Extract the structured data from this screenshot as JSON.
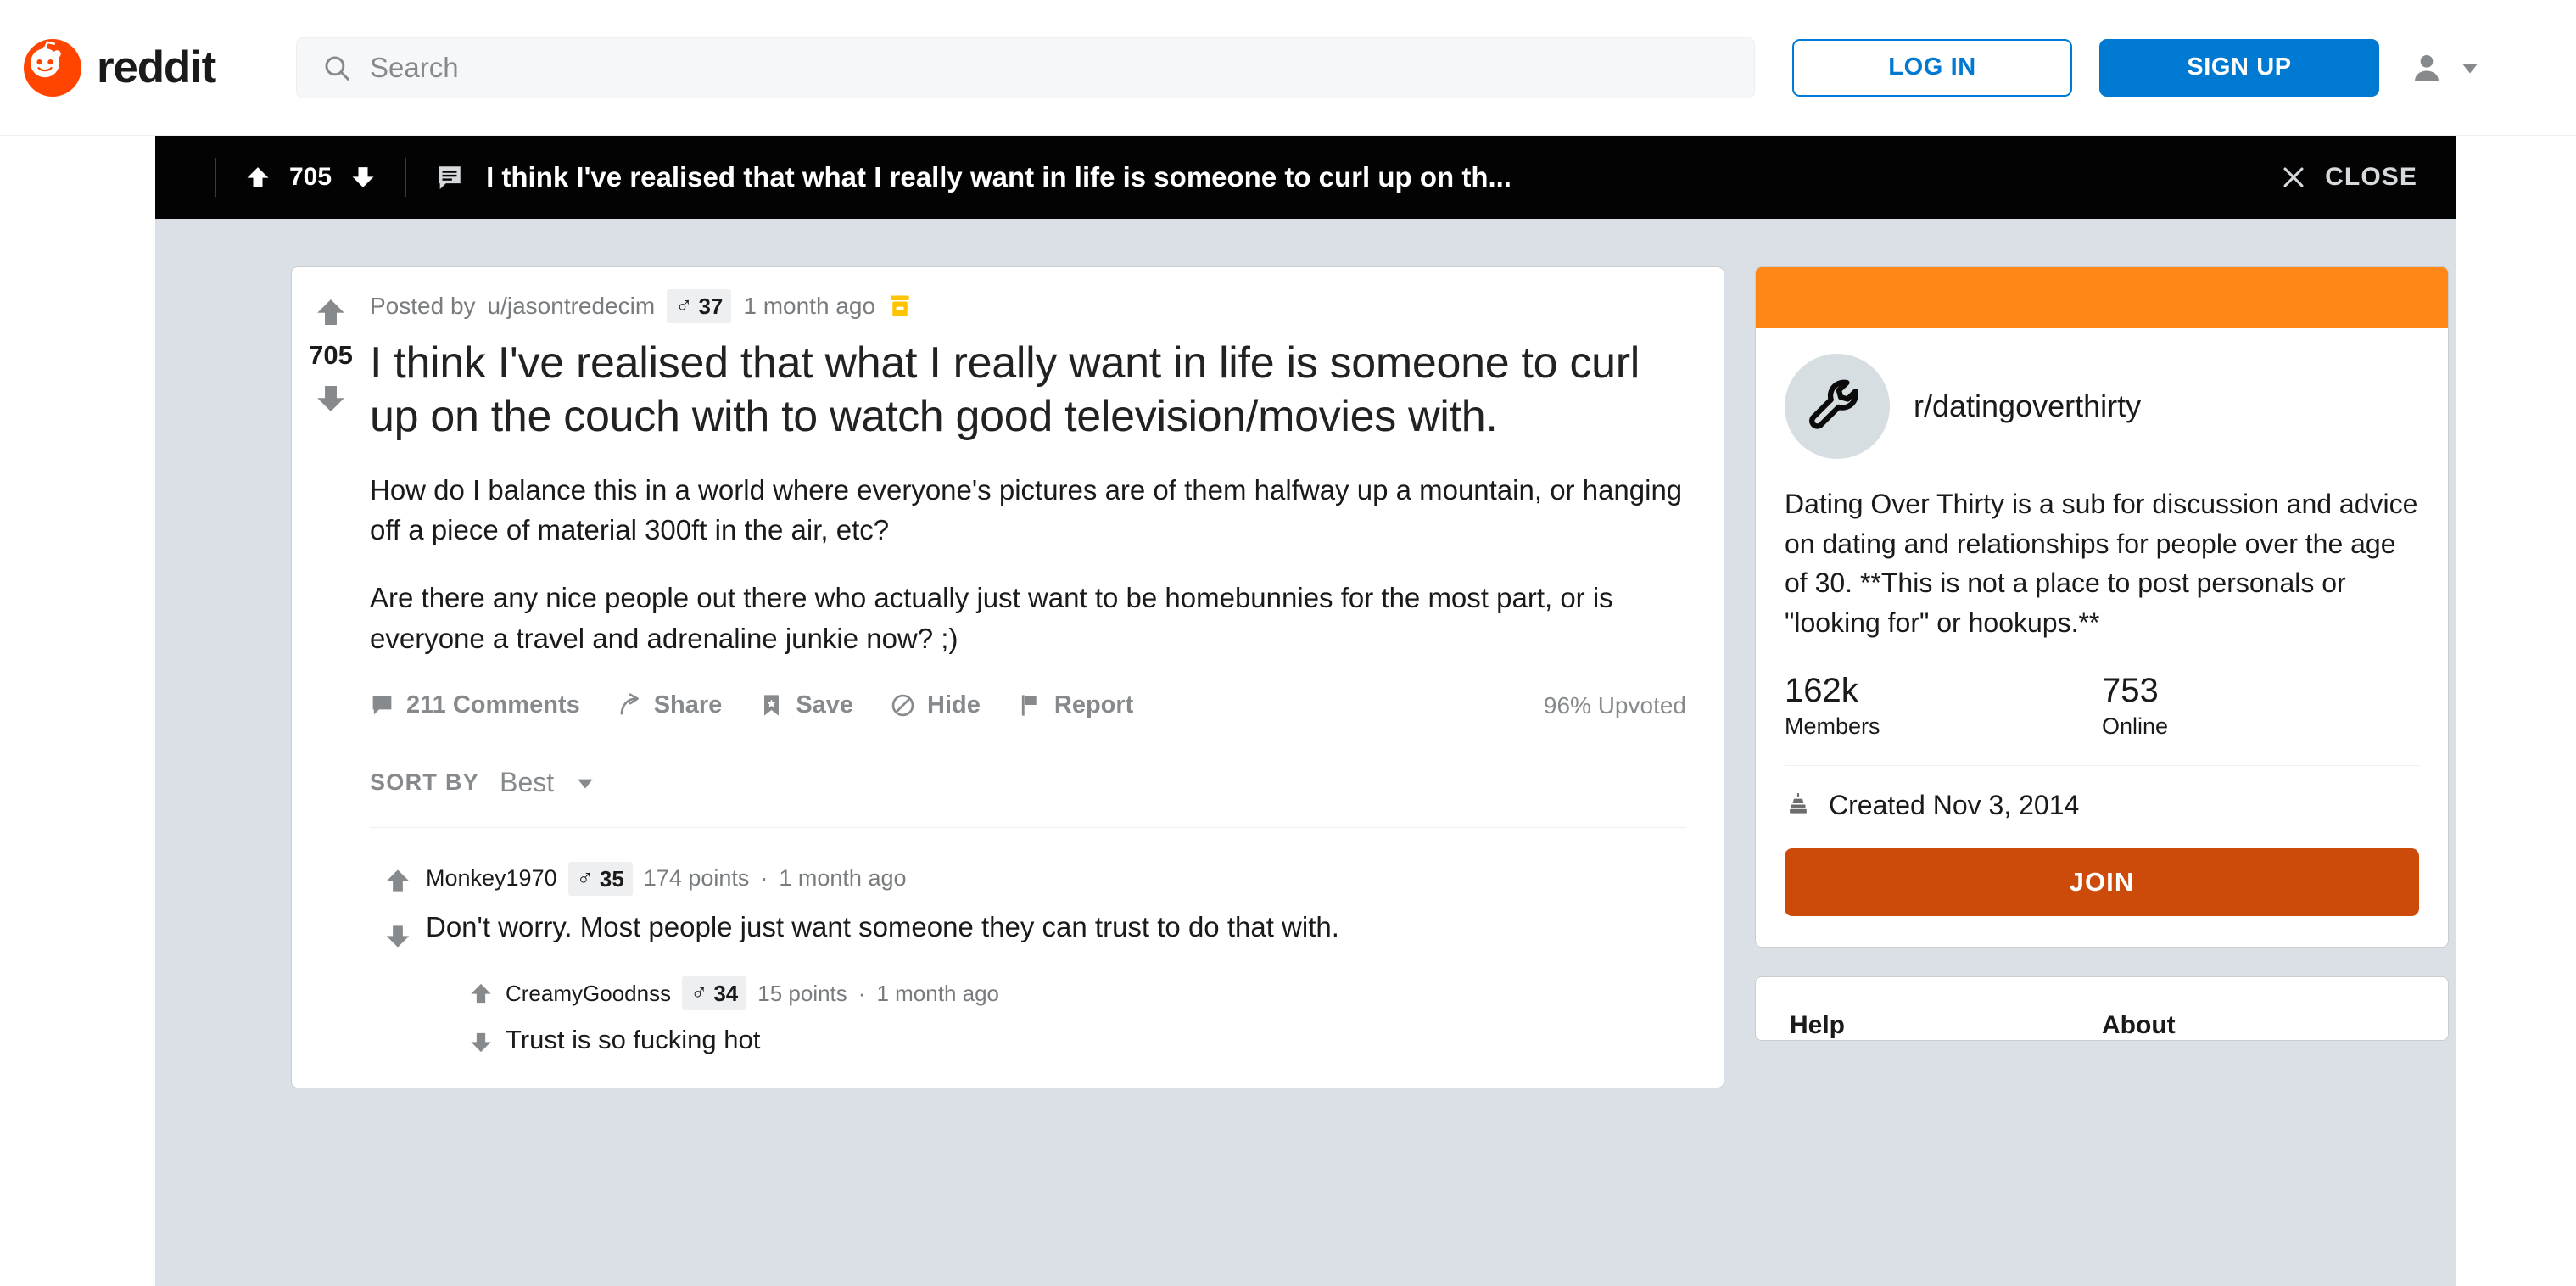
{
  "header": {
    "brand": "reddit",
    "search_placeholder": "Search",
    "login_label": "LOG IN",
    "signup_label": "SIGN UP"
  },
  "sticky_bar": {
    "score": "705",
    "title": "I think I've realised that what I really want in life is someone to curl up on th...",
    "close_label": "CLOSE"
  },
  "post": {
    "score": "705",
    "posted_by_prefix": "Posted by",
    "author": "u/jasontredecim",
    "flair_symbol": "♂",
    "flair_age": "37",
    "timestamp": "1 month ago",
    "title": "I think I've realised that what I really want in life is someone to curl up on the couch with to watch good television/movies with.",
    "paragraph_1": "How do I balance this in a world where everyone's pictures are of them halfway up a mountain, or hanging off a piece of material 300ft in the air, etc?",
    "paragraph_2": "Are there any nice people out there who actually just want to be homebunnies for the most part, or is everyone a travel and adrenaline junkie now? ;)",
    "actions": {
      "comments": "211 Comments",
      "share": "Share",
      "save": "Save",
      "hide": "Hide",
      "report": "Report"
    },
    "upvoted": "96% Upvoted",
    "sort_label": "SORT BY",
    "sort_value": "Best"
  },
  "comments": [
    {
      "author": "Monkey1970",
      "flair_symbol": "♂",
      "flair_age": "35",
      "points": "174 points",
      "dot": "·",
      "timestamp": "1 month ago",
      "text": "Don't worry. Most people just want someone they can trust to do that with."
    },
    {
      "author": "CreamyGoodnss",
      "flair_symbol": "♂",
      "flair_age": "34",
      "points": "15 points",
      "dot": "·",
      "timestamp": "1 month ago",
      "text": "Trust is so fucking hot"
    }
  ],
  "sidebar": {
    "subreddit_name": "r/datingoverthirty",
    "description": "Dating Over Thirty is a sub for discussion and advice on dating and relationships for people over the age of 30. **This is not a place to post personals or \"looking for\" or hookups.**",
    "members_count": "162k",
    "members_label": "Members",
    "online_count": "753",
    "online_label": "Online",
    "created": "Created Nov 3, 2014",
    "join_label": "JOIN",
    "footer_help": "Help",
    "footer_about": "About"
  },
  "colors": {
    "brand_orange": "#FF4500",
    "banner_orange": "#FF8717",
    "join_orange": "#CC4B0A",
    "link_blue": "#0079D3",
    "page_bg": "#DAE0E6",
    "sticky_bg": "#030303",
    "muted_text": "#787C7E"
  }
}
